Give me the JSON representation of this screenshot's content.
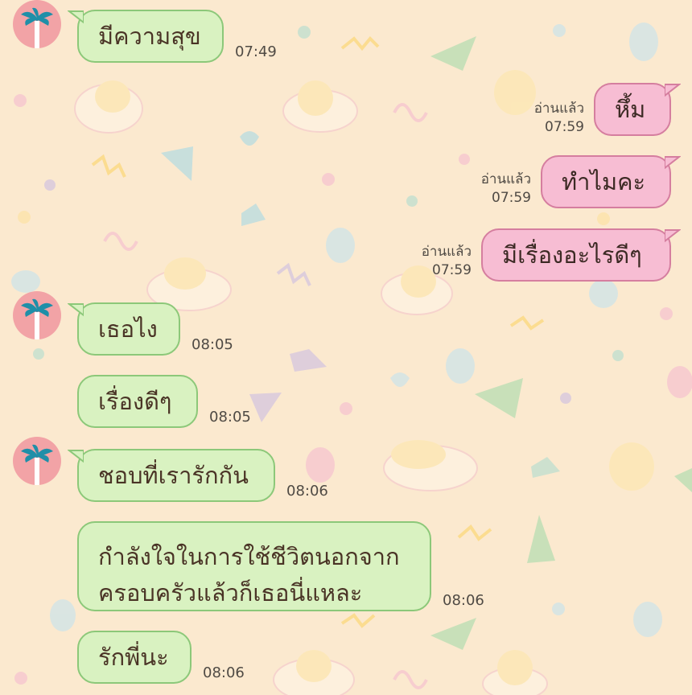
{
  "theme": {
    "in_bubble": "#d9f2c1",
    "in_border": "#8cc879",
    "out_bubble": "#f7bdd3",
    "out_border": "#d57e9f",
    "background": "#fbe9cf",
    "avatar_bg": "#f2a3a6",
    "avatar_icon": "palm-tree-icon"
  },
  "messages": [
    {
      "dir": "in",
      "text": "มีความสุข",
      "time": "07:49"
    },
    {
      "dir": "out",
      "text": "หึ้ม",
      "read": "อ่านแล้ว",
      "time": "07:59"
    },
    {
      "dir": "out",
      "text": "ทำไมคะ",
      "read": "อ่านแล้ว",
      "time": "07:59"
    },
    {
      "dir": "out",
      "text": "มีเรื่องอะไรดีๆ",
      "read": "อ่านแล้ว",
      "time": "07:59"
    },
    {
      "dir": "in",
      "text": "เธอไง",
      "time": "08:05"
    },
    {
      "dir": "in",
      "text": "เรื่องดีๆ",
      "time": "08:05"
    },
    {
      "dir": "in",
      "text": "ชอบที่เรารักกัน",
      "time": "08:06"
    },
    {
      "dir": "in",
      "text": "กำลังใจในการใช้ชีวิตนอกจาก ครอบครัวแล้วก็เธอนี่แหละ",
      "time": "08:06"
    },
    {
      "dir": "in",
      "text": "รักพี่นะ",
      "time": "08:06"
    }
  ]
}
